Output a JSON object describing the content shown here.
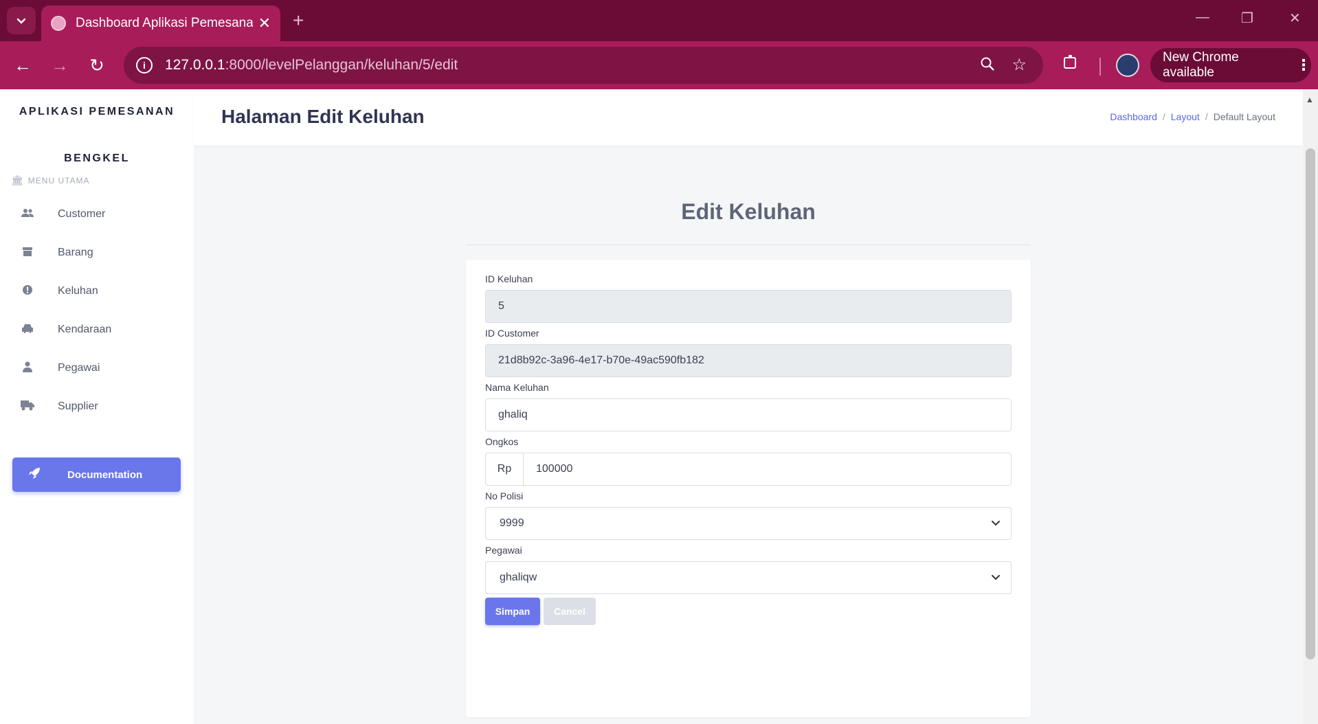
{
  "browser": {
    "tab_title": "Dashboard Aplikasi Pemesanan",
    "url_host": "127.0.0.1",
    "url_rest": ":8000/levelPelanggan/keluhan/5/edit",
    "chrome_update": "New Chrome available",
    "accent": "#a81c5a"
  },
  "sidebar": {
    "brand_line1": "APLIKASI PEMESANAN",
    "brand_line2": "BENGKEL",
    "menu_heading": "MENU UTAMA",
    "items": [
      {
        "label": "Customer",
        "icon": "users-icon"
      },
      {
        "label": "Barang",
        "icon": "box-icon"
      },
      {
        "label": "Keluhan",
        "icon": "alert-circle-icon"
      },
      {
        "label": "Kendaraan",
        "icon": "car-icon"
      },
      {
        "label": "Pegawai",
        "icon": "user-tie-icon"
      },
      {
        "label": "Supplier",
        "icon": "truck-icon"
      }
    ],
    "documentation": "Documentation"
  },
  "header": {
    "title": "Halaman Edit Keluhan",
    "breadcrumb": [
      "Dashboard",
      "Layout",
      "Default Layout"
    ]
  },
  "form": {
    "heading": "Edit Keluhan",
    "id_keluhan": {
      "label": "ID Keluhan",
      "value": "5"
    },
    "id_customer": {
      "label": "ID Customer",
      "value": "21d8b92c-3a96-4e17-b70e-49ac590fb182"
    },
    "nama_keluhan": {
      "label": "Nama Keluhan",
      "value": "ghaliq"
    },
    "ongkos": {
      "label": "Ongkos",
      "prefix": "Rp",
      "value": "100000"
    },
    "no_polisi": {
      "label": "No Polisi",
      "value": "9999"
    },
    "pegawai": {
      "label": "Pegawai",
      "value": "ghaliqw"
    },
    "save_label": "Simpan",
    "cancel_label": "Cancel",
    "primary_color": "#6a77ea"
  }
}
